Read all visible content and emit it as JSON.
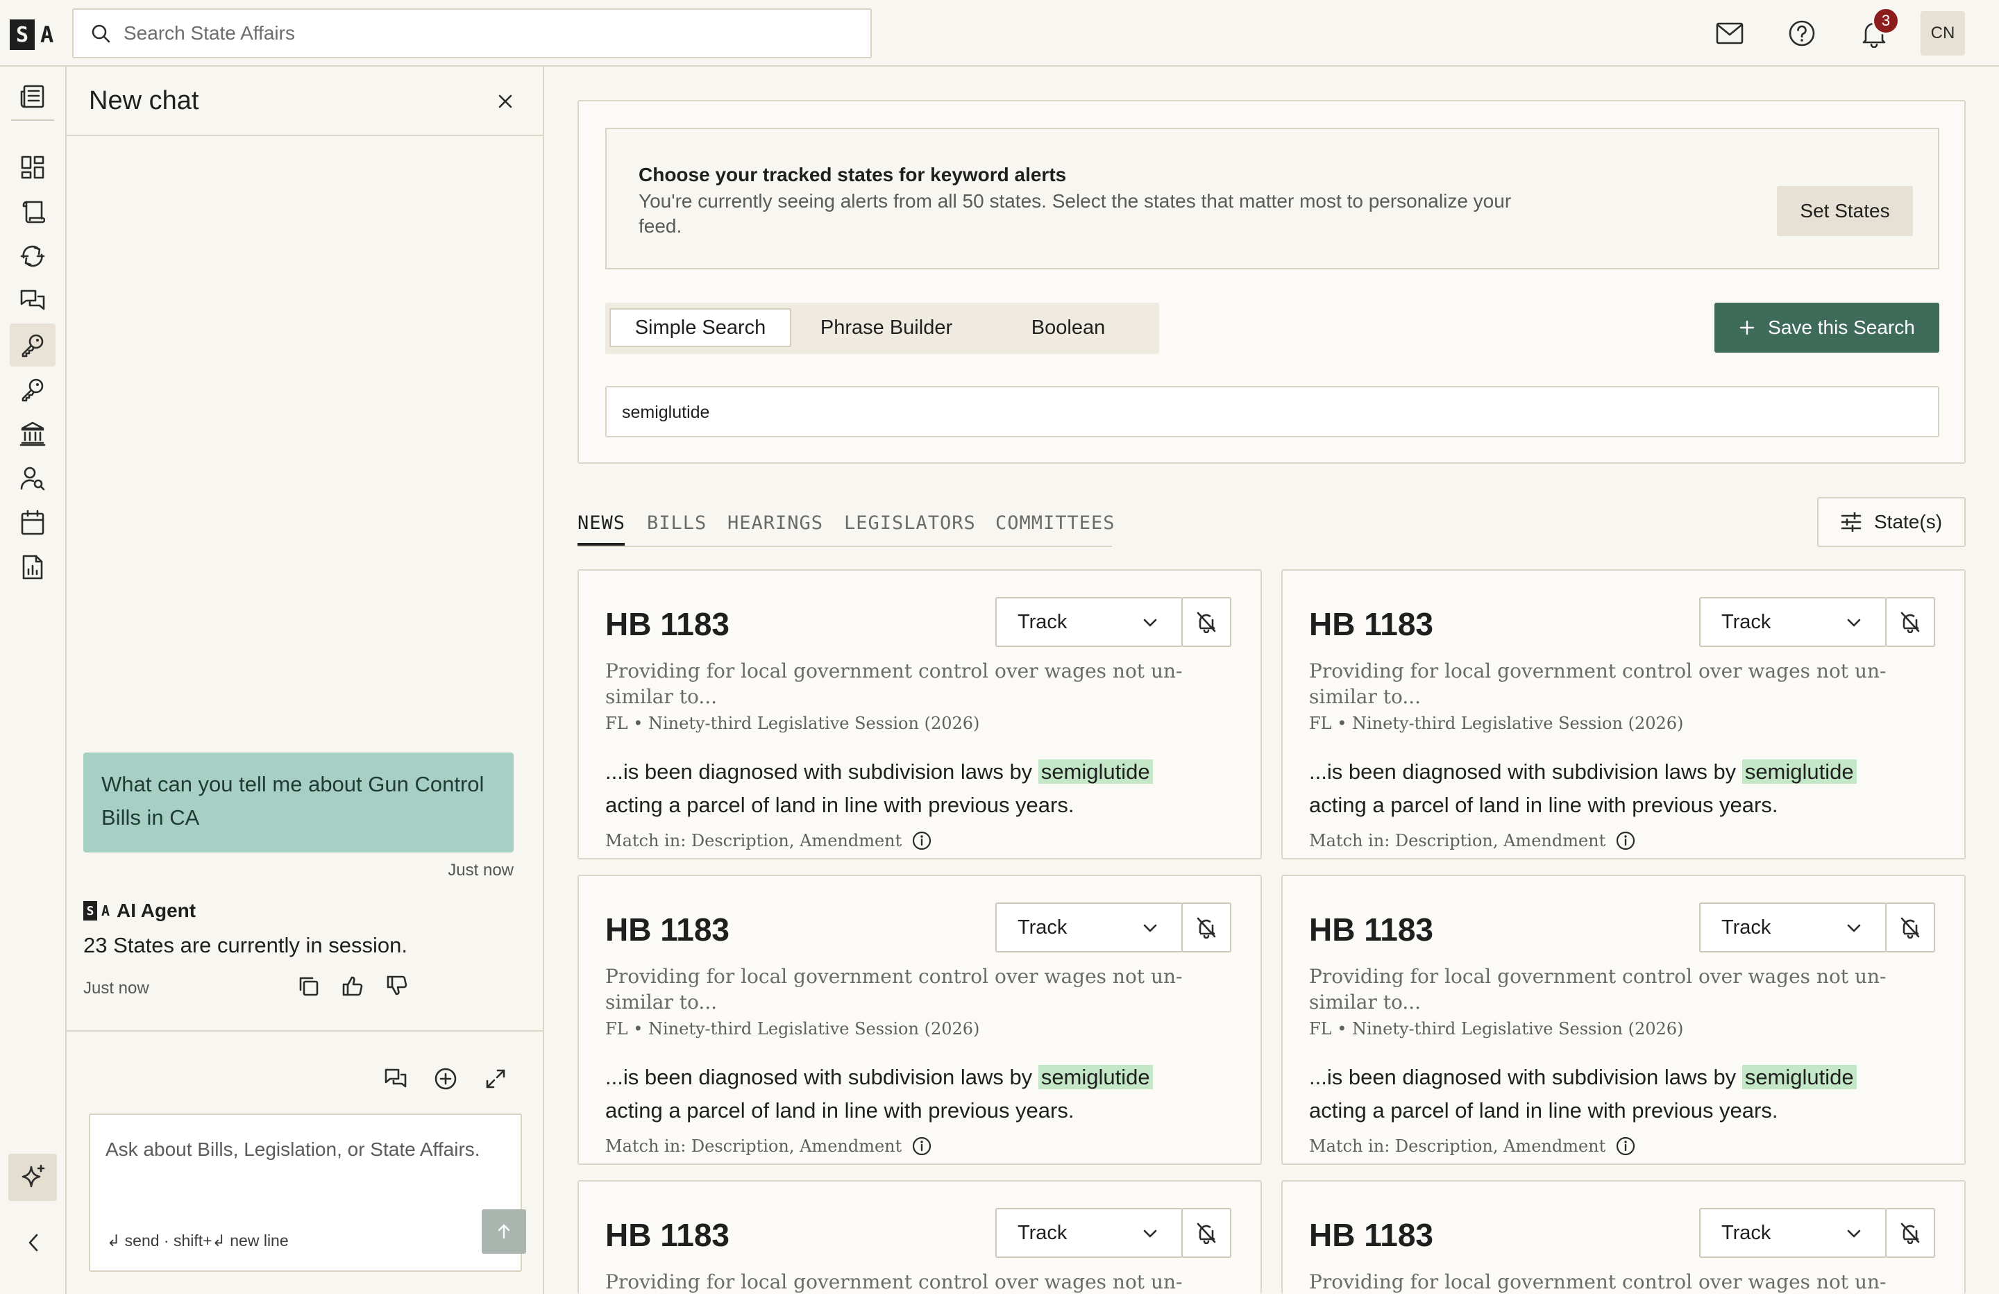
{
  "brand": {
    "logo_block": "S",
    "logo_letter": "A"
  },
  "search": {
    "placeholder": "Search State Affairs"
  },
  "header": {
    "notification_count": "3",
    "avatar_initials": "CN"
  },
  "chat": {
    "title": "New chat",
    "user_message": "What can you tell me about Gun Control Bills in CA",
    "user_time": "Just now",
    "agent_name": "AI Agent",
    "agent_message": "23 States are currently in session.",
    "agent_time": "Just now",
    "input_placeholder": "Ask about Bills, Legislation, or State Affairs.",
    "hint": "↲ send · shift+↲ new line"
  },
  "alerts_banner": {
    "title": "Choose your tracked states for keyword alerts",
    "text": "You're currently seeing alerts from all 50 states. Select the states that matter most to personalize your feed.",
    "button": "Set States"
  },
  "search_modes": {
    "tabs": [
      "Simple Search",
      "Phrase Builder",
      "Boolean"
    ],
    "active": "Simple Search",
    "save_button": "Save this Search"
  },
  "query": {
    "value": "semiglutide"
  },
  "result_tabs": {
    "tabs": [
      "NEWS",
      "BILLS",
      "HEARINGS",
      "LEGISLATORS",
      "COMMITTEES"
    ],
    "active": "NEWS",
    "filter_button": "State(s)"
  },
  "results": [
    {
      "title": "HB 1183",
      "track": "Track",
      "description": "Providing for local government control over wages not un-similar to...",
      "meta": "FL • Ninety-third Legislative Session (2026)",
      "snippet_before": "...is been diagnosed with subdivision laws by",
      "snippet_highlight": "semiglutide",
      "snippet_after": "acting a parcel of land in line with previous years.",
      "match": "Match in: Description, Amendment"
    },
    {
      "title": "HB 1183",
      "track": "Track",
      "description": "Providing for local government control over wages not un-similar to...",
      "meta": "FL • Ninety-third Legislative Session (2026)",
      "snippet_before": "...is been diagnosed with subdivision laws by",
      "snippet_highlight": "semiglutide",
      "snippet_after": "acting a parcel of land in line with previous years.",
      "match": "Match in: Description, Amendment"
    },
    {
      "title": "HB 1183",
      "track": "Track",
      "description": "Providing for local government control over wages not un-similar to...",
      "meta": "FL • Ninety-third Legislative Session (2026)",
      "snippet_before": "...is been diagnosed with subdivision laws by",
      "snippet_highlight": "semiglutide",
      "snippet_after": "acting a parcel of land in line with previous years.",
      "match": "Match in: Description, Amendment"
    },
    {
      "title": "HB 1183",
      "track": "Track",
      "description": "Providing for local government control over wages not un-similar to...",
      "meta": "FL • Ninety-third Legislative Session (2026)",
      "snippet_before": "...is been diagnosed with subdivision laws by",
      "snippet_highlight": "semiglutide",
      "snippet_after": "acting a parcel of land in line with previous years.",
      "match": "Match in: Description, Amendment"
    },
    {
      "title": "HB 1183",
      "track": "Track",
      "description": "Providing for local government control over wages not un-similar",
      "meta": "",
      "snippet_before": "",
      "snippet_highlight": "",
      "snippet_after": "",
      "match": ""
    },
    {
      "title": "HB 1183",
      "track": "Track",
      "description": "Providing for local government control over wages not un-similar",
      "meta": "",
      "snippet_before": "",
      "snippet_highlight": "",
      "snippet_after": "",
      "match": ""
    }
  ],
  "colors": {
    "background": "#f8f6f0",
    "user_bubble": "#a8cfc3",
    "primary_button": "#3f6b5a",
    "highlight": "#c4e7c8",
    "badge": "#8c1d1d"
  },
  "icons": {
    "rail": [
      "newspaper-icon",
      "dashboard-icon",
      "scroll-icon",
      "cycle-icon",
      "chat-icon",
      "key-icon",
      "key-icon",
      "capitol-icon",
      "user-search-icon",
      "calendar-icon",
      "report-icon",
      "sparkle-icon",
      "chevron-left-icon"
    ],
    "header": [
      "search-icon",
      "mail-icon",
      "help-icon",
      "bell-icon"
    ]
  }
}
